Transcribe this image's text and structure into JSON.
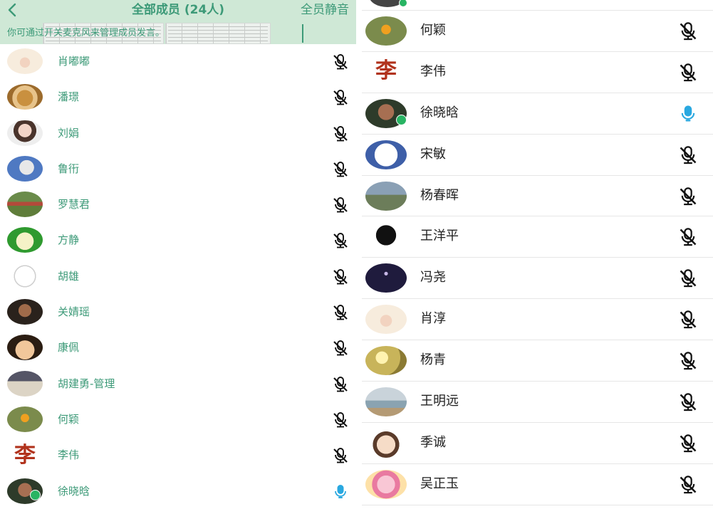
{
  "header": {
    "title": "全部成员 (24人)",
    "mute_all": "全员静音",
    "hint": "你可通过开关麦克风来管理成员发言。"
  },
  "colors": {
    "accent_green": "#3d9a78",
    "header_bg": "#cfe8d6",
    "mic_active": "#29a8e0",
    "mic_muted": "#111111",
    "online_badge": "#28b463"
  },
  "left_members": [
    {
      "name": "肖嘟嘟",
      "avatar": "av-cream",
      "mic": "muted"
    },
    {
      "name": "潘璟",
      "avatar": "av-dog",
      "mic": "muted"
    },
    {
      "name": "刘娟",
      "avatar": "av-girl",
      "mic": "muted"
    },
    {
      "name": "鲁衎",
      "avatar": "av-blue",
      "mic": "muted"
    },
    {
      "name": "罗慧君",
      "avatar": "av-field",
      "mic": "muted"
    },
    {
      "name": "方静",
      "avatar": "av-green",
      "mic": "muted"
    },
    {
      "name": "胡雄",
      "avatar": "av-sketch",
      "mic": "muted"
    },
    {
      "name": "关婧瑶",
      "avatar": "av-man2",
      "mic": "muted"
    },
    {
      "name": "康佩",
      "avatar": "av-cartoon",
      "mic": "muted"
    },
    {
      "name": "胡建勇-管理",
      "avatar": "av-suit",
      "mic": "muted"
    },
    {
      "name": "何颖",
      "avatar": "av-flower",
      "mic": "muted"
    },
    {
      "name": "李伟",
      "avatar": "av-calli",
      "mic": "muted"
    },
    {
      "name": "徐晓晗",
      "avatar": "av-xu",
      "mic": "active",
      "badge": true
    }
  ],
  "right_members": [
    {
      "name": "何颖",
      "avatar": "av-flower",
      "mic": "muted"
    },
    {
      "name": "李伟",
      "avatar": "av-calli",
      "mic": "muted"
    },
    {
      "name": "徐晓晗",
      "avatar": "av-xu",
      "mic": "active",
      "badge": true
    },
    {
      "name": "宋敏",
      "avatar": "av-sm",
      "mic": "muted"
    },
    {
      "name": "杨春晖",
      "avatar": "av-yang",
      "mic": "muted"
    },
    {
      "name": "王洋平",
      "avatar": "av-qq",
      "mic": "muted"
    },
    {
      "name": "冯尧",
      "avatar": "av-night",
      "mic": "muted"
    },
    {
      "name": "肖淳",
      "avatar": "av-xiao",
      "mic": "muted"
    },
    {
      "name": "杨青",
      "avatar": "av-yq",
      "mic": "muted"
    },
    {
      "name": "王明远",
      "avatar": "av-beach",
      "mic": "muted"
    },
    {
      "name": "季诚",
      "avatar": "av-boy",
      "mic": "muted"
    },
    {
      "name": "吴正玉",
      "avatar": "av-anime",
      "mic": "muted"
    }
  ],
  "calligraphy_glyph": "李",
  "icons": {
    "back": "chevron-left-icon",
    "mic_muted": "mic-off-icon",
    "mic_active": "mic-on-icon"
  }
}
